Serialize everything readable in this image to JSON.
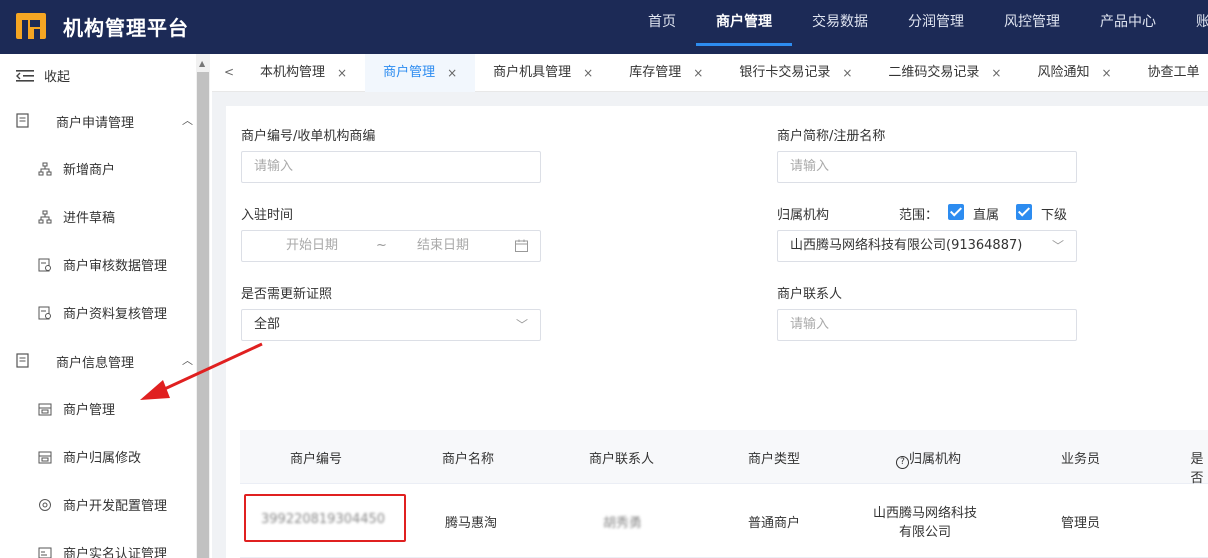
{
  "app": {
    "title": "机构管理平台"
  },
  "topnav": {
    "items": [
      "首页",
      "商户管理",
      "交易数据",
      "分润管理",
      "风控管理",
      "产品中心",
      "账"
    ],
    "active_index": 1
  },
  "sidebar": {
    "collapse_label": "收起",
    "groups": [
      {
        "label": "商户申请管理",
        "items": [
          "新增商户",
          "进件草稿",
          "商户审核数据管理",
          "商户资料复核管理"
        ]
      },
      {
        "label": "商户信息管理",
        "items": [
          "商户管理",
          "商户归属修改",
          "商户开发配置管理",
          "商户实名认证管理"
        ]
      }
    ]
  },
  "tabs": {
    "items": [
      "本机构管理",
      "商户管理",
      "商户机具管理",
      "库存管理",
      "银行卡交易记录",
      "二维码交易记录",
      "风险通知",
      "协查工单"
    ],
    "active_index": 1,
    "close_glyph": "×"
  },
  "form": {
    "merchant_no_label": "商户编号/收单机构商编",
    "merchant_no_placeholder": "请输入",
    "merchant_name_label": "商户简称/注册名称",
    "merchant_name_placeholder": "请输入",
    "join_time_label": "入驻时间",
    "start_date_placeholder": "开始日期",
    "date_separator": "~",
    "end_date_placeholder": "结束日期",
    "org_label": "归属机构",
    "scope_label": "范围：",
    "scope_direct": "直属",
    "scope_sub": "下级",
    "org_value": "山西腾马网络科技有限公司(91364887)",
    "renew_label": "是否需更新证照",
    "renew_value": "全部",
    "contact_label": "商户联系人",
    "contact_placeholder": "请输入"
  },
  "table": {
    "columns": [
      "商户编号",
      "商户名称",
      "商户联系人",
      "商户类型",
      "归属机构",
      "业务员",
      "是否"
    ],
    "rows": [
      {
        "merchant_no": "399220819304450",
        "merchant_name": "腾马惠淘",
        "contact": "胡秀勇",
        "type": "普通商户",
        "org_line1": "山西腾马网络科技",
        "org_line2": "有限公司",
        "salesman": "管理员"
      }
    ]
  },
  "colors": {
    "topbar": "#1c2a56",
    "accent": "#2d8cf0",
    "annotation": "#e02020",
    "logo": "#f5a623"
  }
}
